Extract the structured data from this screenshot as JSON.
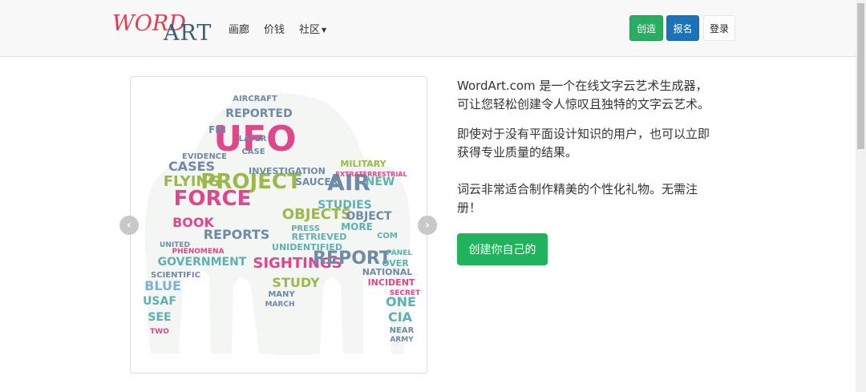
{
  "nav": {
    "logo_word": "WORD",
    "logo_art": "ART",
    "links": [
      "画廊",
      "价钱",
      "社区"
    ],
    "create_label": "创造",
    "signup_label": "报名",
    "login_label": "登录"
  },
  "main": {
    "paragraph1_line1": "WordArt.com 是一个在线文字云艺术生成器，",
    "paragraph1_line2": "可让您轻松创建令人惊叹且独特的文字云艺术。",
    "paragraph2_line1": "即使对于没有平面设计知识的用户，也可以立即",
    "paragraph2_line2": "获得专业质量的结果。",
    "paragraph3_line1": "词云非常适合制作精美的个性化礼物。无需注",
    "paragraph3_line2": "册！",
    "cta_label": "创建你自己的"
  },
  "carousel": {
    "words": [
      "UFO",
      "REPORTED",
      "AIRCRAFT",
      "PROJECT",
      "AIR",
      "FORCE",
      "FLYING",
      "CASES",
      "OBJECTS",
      "BOOK",
      "REPORTS",
      "SIGHTINGS",
      "REPORT",
      "GOVERNMENT",
      "STUDY",
      "INVESTIGATION",
      "MILITARY",
      "STUDIES",
      "OBJECT",
      "UNIDENTIFIED",
      "RETRIEVED",
      "PRESS",
      "PHENOMENA",
      "BLUE",
      "USAF",
      "SEE",
      "NEW",
      "SAUCER",
      "CIA",
      "ONE",
      "INCIDENT",
      "NATIONAL",
      "EVIDENCE",
      "EXTRATERRESTRIAL",
      "SECRET",
      "MORE",
      "SCIENTIFIC",
      "UNITED",
      "TWO",
      "MANY",
      "MARCH",
      "CASE",
      "LATER",
      "FBI",
      "COM",
      "OVER",
      "PANEL",
      "NEAR",
      "ARMY"
    ],
    "prev_icon": "chevron-left-icon",
    "next_icon": "chevron-right-icon"
  },
  "colors": {
    "pink": "#e0468c",
    "blue_gray": "#6e8aa8",
    "teal": "#5fb0b0",
    "green": "#9bb84a",
    "light_blue": "#7fb0d8",
    "btn_green": "#27ae60",
    "btn_blue": "#1a73b8"
  }
}
